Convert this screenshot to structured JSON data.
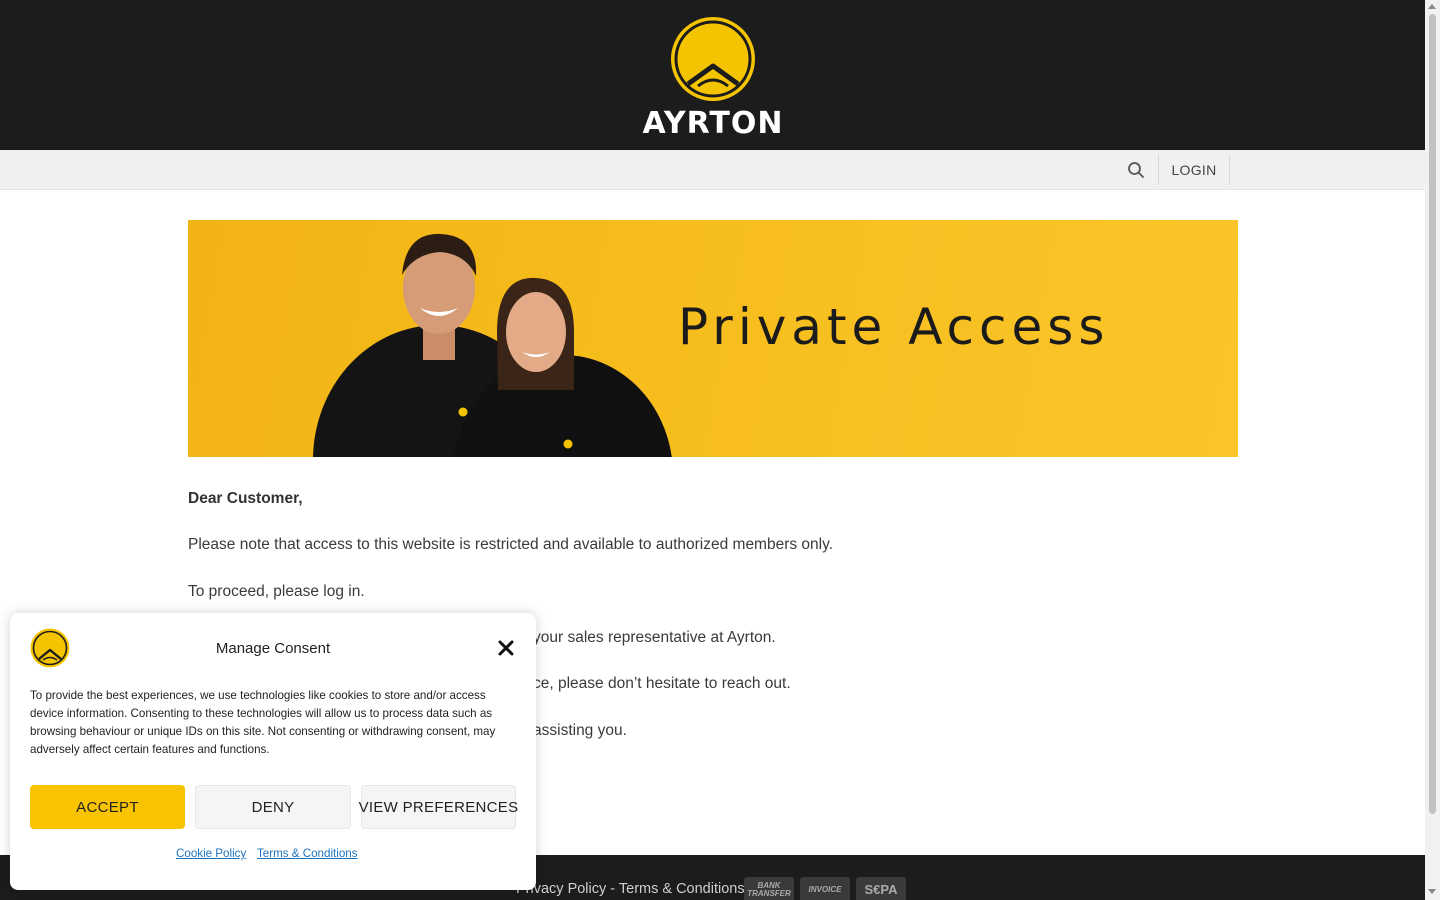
{
  "header": {
    "brand_name": "AYRTON"
  },
  "nav": {
    "login_label": "LOGIN",
    "search_icon": "search-icon"
  },
  "banner": {
    "title": "Private Access"
  },
  "content": {
    "greeting": "Dear Customer,",
    "line1": "Please note that access to this website is restricted and available to authorized members only.",
    "line2": "To proceed, please log in.",
    "line3_visible": "your sales representative at Ayrton.",
    "line4_visible": "ce, please don’t hesitate to reach out.",
    "line5_visible": "assisting you."
  },
  "footer": {
    "privacy_policy": "Privacy Policy",
    "separator": " - ",
    "terms": "Terms & Conditions",
    "payment_badges": [
      "BANK TRANSFER",
      "INVOICE",
      "S€PA"
    ]
  },
  "consent": {
    "title": "Manage Consent",
    "text": "To provide the best experiences, we use technologies like cookies to store and/or access device information. Consenting to these technologies will allow us to process data such as browsing behaviour or unique IDs on this site. Not consenting or withdrawing consent, may adversely affect certain features and functions.",
    "accept_label": "ACCEPT",
    "deny_label": "DENY",
    "preferences_label": "VIEW PREFERENCES",
    "cookie_policy_link": "Cookie Policy",
    "terms_link": "Terms & Conditions"
  },
  "colors": {
    "brand_yellow": "#f9c300",
    "header_dark": "#1c1c1c",
    "nav_gray": "#f0f0f0"
  }
}
